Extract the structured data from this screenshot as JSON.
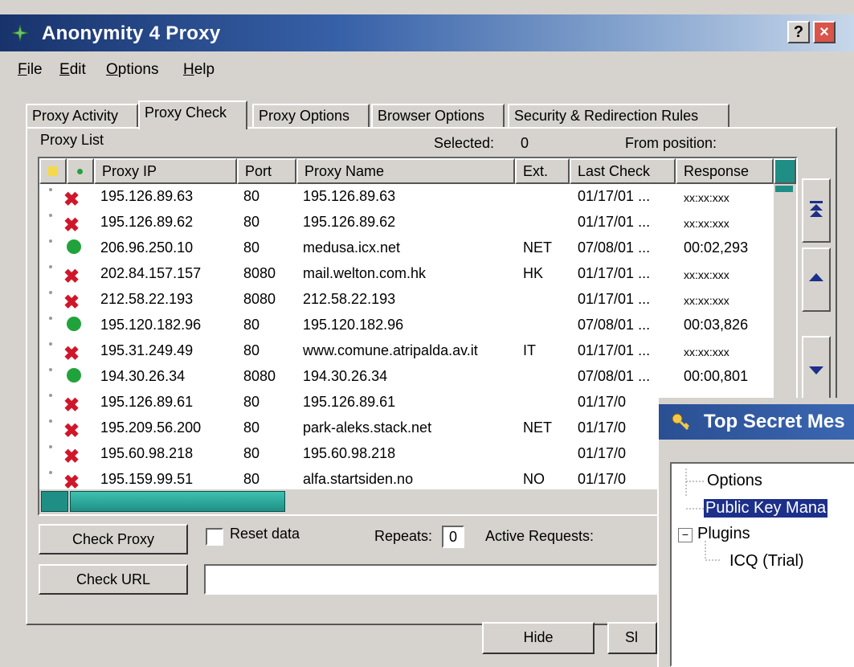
{
  "window": {
    "title": "Anonymity 4 Proxy",
    "help_btn": "?",
    "close_btn": "×"
  },
  "menu": [
    {
      "accel": "F",
      "rest": "ile"
    },
    {
      "accel": "E",
      "rest": "dit"
    },
    {
      "accel": "O",
      "rest": "ptions"
    },
    {
      "accel": "H",
      "rest": "elp"
    }
  ],
  "tabs": [
    "Proxy Activity",
    "Proxy Check",
    "Proxy Options",
    "Browser Options",
    "Security & Redirection Rules"
  ],
  "active_tab": "Proxy Check",
  "proxy_list": {
    "label": "Proxy List",
    "selected_label": "Selected:",
    "selected_value": "0",
    "from_position_label": "From position:",
    "columns": [
      "Proxy IP",
      "Port",
      "Proxy Name",
      "Ext.",
      "Last Check",
      "Response"
    ],
    "rows": [
      {
        "status": "fail",
        "ip": "195.126.89.63",
        "port": "80",
        "name": "195.126.89.63",
        "ext": "",
        "last": "01/17/01 ...",
        "resp": "xx:xx:xxx"
      },
      {
        "status": "fail",
        "ip": "195.126.89.62",
        "port": "80",
        "name": "195.126.89.62",
        "ext": "",
        "last": "01/17/01 ...",
        "resp": "xx:xx:xxx"
      },
      {
        "status": "ok",
        "ip": "206.96.250.10",
        "port": "80",
        "name": "medusa.icx.net",
        "ext": "NET",
        "last": "07/08/01 ...",
        "resp": "00:02,293"
      },
      {
        "status": "fail",
        "ip": "202.84.157.157",
        "port": "8080",
        "name": "mail.welton.com.hk",
        "ext": "HK",
        "last": "01/17/01 ...",
        "resp": "xx:xx:xxx"
      },
      {
        "status": "fail",
        "ip": "212.58.22.193",
        "port": "8080",
        "name": "212.58.22.193",
        "ext": "",
        "last": "01/17/01 ...",
        "resp": "xx:xx:xxx"
      },
      {
        "status": "ok",
        "ip": "195.120.182.96",
        "port": "80",
        "name": "195.120.182.96",
        "ext": "",
        "last": "07/08/01 ...",
        "resp": "00:03,826"
      },
      {
        "status": "fail",
        "ip": "195.31.249.49",
        "port": "80",
        "name": "www.comune.atripalda.av.it",
        "ext": "IT",
        "last": "01/17/01 ...",
        "resp": "xx:xx:xxx"
      },
      {
        "status": "ok",
        "ip": "194.30.26.34",
        "port": "8080",
        "name": "194.30.26.34",
        "ext": "",
        "last": "07/08/01 ...",
        "resp": "00:00,801"
      },
      {
        "status": "fail",
        "ip": "195.126.89.61",
        "port": "80",
        "name": "195.126.89.61",
        "ext": "",
        "last": "01/17/0",
        "resp": ""
      },
      {
        "status": "fail",
        "ip": "195.209.56.200",
        "port": "80",
        "name": "park-aleks.stack.net",
        "ext": "NET",
        "last": "01/17/0",
        "resp": ""
      },
      {
        "status": "fail",
        "ip": "195.60.98.218",
        "port": "80",
        "name": "195.60.98.218",
        "ext": "",
        "last": "01/17/0",
        "resp": ""
      },
      {
        "status": "fail",
        "ip": "195.159.99.51",
        "port": "80",
        "name": "alfa.startsiden.no",
        "ext": "NO",
        "last": "01/17/0",
        "resp": ""
      }
    ]
  },
  "controls": {
    "check_proxy": "Check Proxy",
    "reset_data": "Reset data",
    "repeats_label": "Repeats:",
    "repeats_value": "0",
    "active_requests": "Active Requests:",
    "check_url": "Check URL",
    "hide": "Hide",
    "partial_btn": "Sl"
  },
  "secret_window": {
    "title": "Top Secret Mes",
    "tree": [
      "Options",
      "Public Key Mana",
      "Plugins",
      "ICQ (Trial)"
    ],
    "expander": "−"
  },
  "colors": {
    "fail": "#d0162a",
    "ok": "#21a33b",
    "selection": "#1c2f8a"
  }
}
